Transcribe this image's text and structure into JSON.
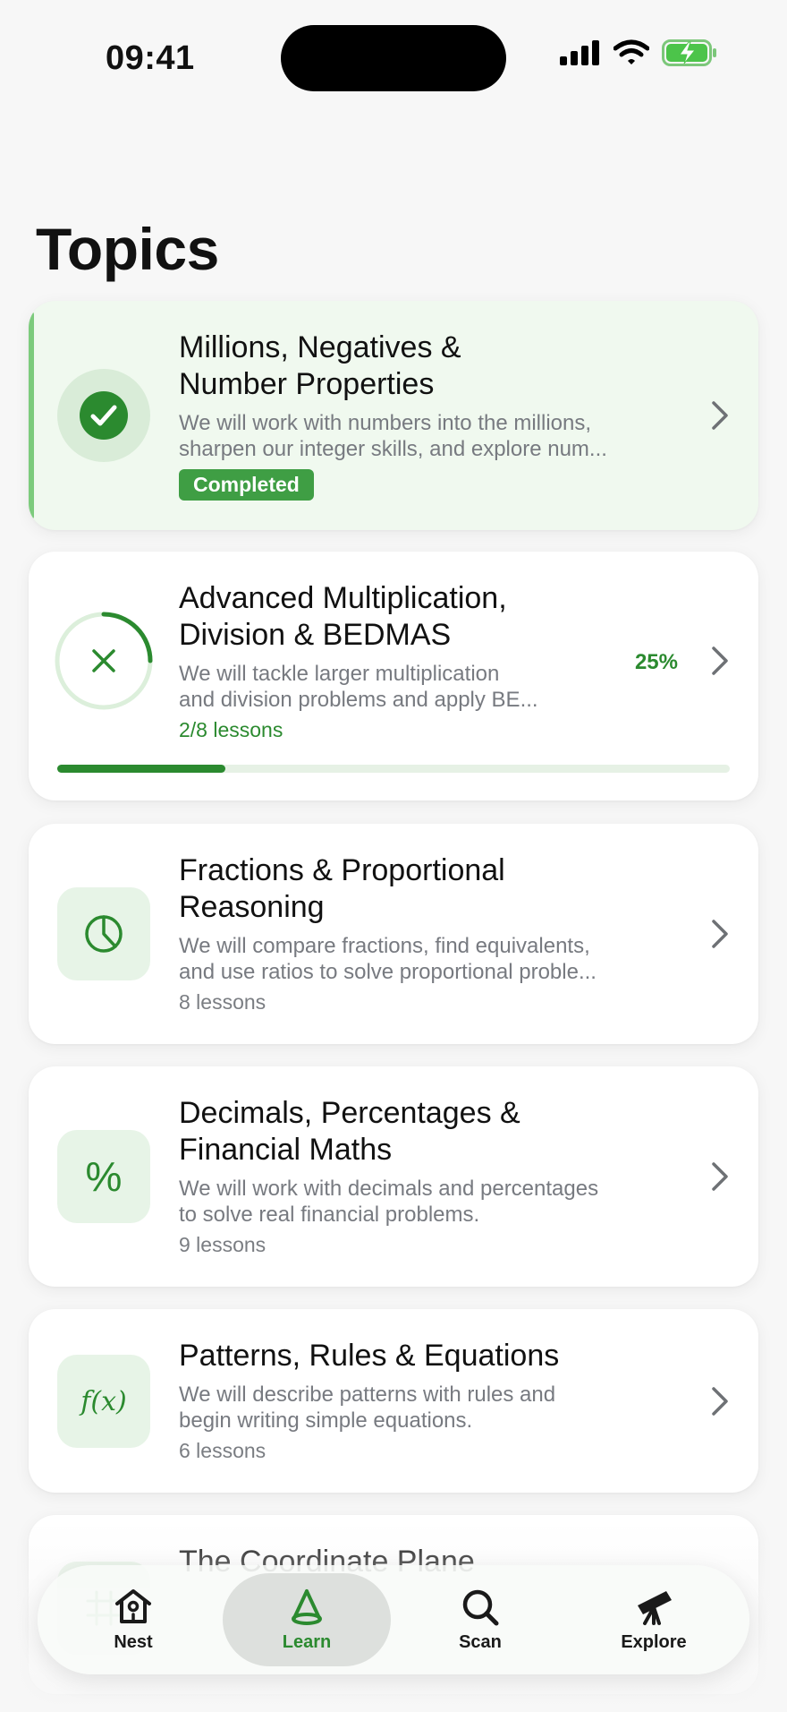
{
  "status_bar": {
    "time": "09:41"
  },
  "page": {
    "title": "Topics"
  },
  "topics": [
    {
      "title_line1": "Millions, Negatives &",
      "title_line2": "Number Properties",
      "desc_line1": "We will work with numbers into the millions,",
      "desc_line2": "sharpen our integer skills, and explore num...",
      "badge": "Completed",
      "icon": "checkmark-icon"
    },
    {
      "title_line1": "Advanced Multiplication,",
      "title_line2": "Division & BEDMAS",
      "desc_line1": "We will tackle larger multiplication",
      "desc_line2": "and division problems and apply BE...",
      "meta": "2/8 lessons",
      "percent_label": "25%",
      "progress": 0.25,
      "icon": "multiply-icon"
    },
    {
      "title_line1": "Fractions & Proportional",
      "title_line2": "Reasoning",
      "desc_line1": "We will compare fractions, find equivalents,",
      "desc_line2": "and use ratios to solve proportional proble...",
      "meta": "8 lessons",
      "icon": "pie-chart-icon"
    },
    {
      "title_line1": "Decimals, Percentages &",
      "title_line2": "Financial Maths",
      "desc_line1": "We will work with decimals and percentages",
      "desc_line2": "to solve real financial problems.",
      "meta": "9 lessons",
      "icon_text": "%",
      "icon": "percent-icon"
    },
    {
      "title_line1": "Patterns, Rules & Equations",
      "desc_line1": "We will describe patterns with rules and",
      "desc_line2": "begin writing simple equations.",
      "meta": "6 lessons",
      "icon_text": "f(x)",
      "icon": "function-icon"
    },
    {
      "title_line1": "The Coordinate Plane",
      "icon": "grid-icon"
    }
  ],
  "tab_bar": {
    "items": [
      {
        "label": "Nest",
        "icon": "birdhouse-icon"
      },
      {
        "label": "Learn",
        "icon": "cone-icon",
        "active": true
      },
      {
        "label": "Scan",
        "icon": "search-icon"
      },
      {
        "label": "Explore",
        "icon": "telescope-icon"
      }
    ]
  },
  "colors": {
    "accent": "#2b8a2f",
    "badge": "#3f9e44",
    "completed_bg": "#f0f9ef"
  }
}
